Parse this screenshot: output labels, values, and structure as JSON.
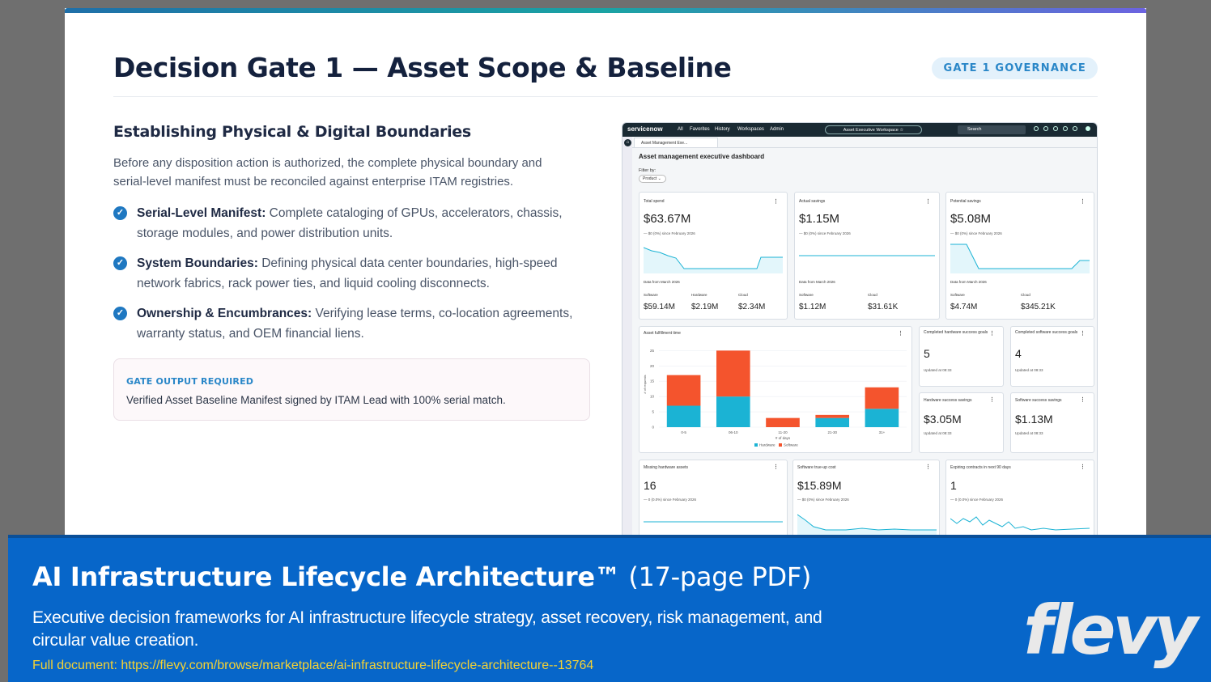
{
  "slide": {
    "title": "Decision Gate 1 — Asset Scope & Baseline",
    "badge": "GATE 1 GOVERNANCE",
    "subheading": "Establishing Physical & Digital Boundaries",
    "intro": "Before any disposition action is authorized, the complete physical boundary and serial-level manifest must be reconciled against enterprise ITAM registries.",
    "bullets": [
      {
        "title": "Serial-Level Manifest:",
        "text": " Complete cataloging of GPUs, accelerators, chassis, storage modules, and power distribution units."
      },
      {
        "title": "System Boundaries:",
        "text": " Defining physical data center boundaries, high-speed network fabrics, rack power ties, and liquid cooling disconnects."
      },
      {
        "title": "Ownership & Encumbrances:",
        "text": " Verifying lease terms, co-location agreements, warranty status, and OEM financial liens."
      }
    ],
    "output": {
      "label": "GATE OUTPUT REQUIRED",
      "text": "Verified Asset Baseline Manifest signed by ITAM Lead with 100% serial match."
    }
  },
  "dashboard": {
    "brand": "servicenow",
    "nav": [
      "All",
      "Favorites",
      "History",
      "Workspaces",
      "Admin"
    ],
    "workspace": "Asset Executive Workspace ☆",
    "search_placeholder": "Search",
    "tab": "Asset Management Exe...",
    "title": "Asset management executive dashboard",
    "filter_label": "Filter by:",
    "filter_value": "Product ⌄",
    "kpis": [
      {
        "label": "Total spend",
        "value": "$63.67M",
        "sub": "— $0 (0%) since February 2026",
        "from": "Data from March 2026",
        "breakdown": [
          {
            "label": "Software",
            "value": "$59.14M"
          },
          {
            "label": "Hardware",
            "value": "$2.19M"
          },
          {
            "label": "Cloud",
            "value": "$2.34M"
          }
        ]
      },
      {
        "label": "Actual savings",
        "value": "$1.15M",
        "sub": "— $0 (0%) since February 2026",
        "from": "Data from March 2026",
        "breakdown": [
          {
            "label": "Software",
            "value": "$1.12M"
          },
          {
            "label": "Cloud",
            "value": "$31.61K"
          }
        ]
      },
      {
        "label": "Potential savings",
        "value": "$5.08M",
        "sub": "— $0 (0%) since February 2026",
        "from": "Data from March 2026",
        "breakdown": [
          {
            "label": "Software",
            "value": "$4.74M"
          },
          {
            "label": "Cloud",
            "value": "$345.21K"
          }
        ]
      }
    ],
    "goals": [
      {
        "label": "Completed hardware success goals",
        "value": "5",
        "updated": "Updated at 08:33"
      },
      {
        "label": "Completed software success goals",
        "value": "4",
        "updated": "Updated at 08:33"
      },
      {
        "label": "Hardware success savings",
        "value": "$3.05M",
        "updated": "Updated at 08:33"
      },
      {
        "label": "Software success savings",
        "value": "$1.13M",
        "updated": "Updated at 08:33"
      }
    ],
    "bottom": [
      {
        "label": "Missing hardware assets",
        "value": "16",
        "sub": "— 0 (0.0%) since February 2026"
      },
      {
        "label": "Software true-up cost",
        "value": "$15.89M",
        "sub": "— $0 (0%) since February 2026"
      },
      {
        "label": "Expiring contracts in next 90 days",
        "value": "1",
        "sub": "— 0 (0.0%) since February 2026"
      }
    ],
    "chart_data": {
      "type": "bar",
      "title": "Asset fulfillment time",
      "categories": [
        "0-5",
        "06-10",
        "11-20",
        "21-30",
        "31+"
      ],
      "series": [
        {
          "name": "Hardware",
          "values": [
            7,
            10,
            0,
            3,
            6
          ],
          "color": "#1bb3d4"
        },
        {
          "name": "Software",
          "values": [
            10,
            15,
            3,
            1,
            7
          ],
          "color": "#f4542d"
        }
      ],
      "stacked": true,
      "xlabel": "# of days",
      "ylabel": "# of requests",
      "yticks": [
        0,
        5,
        10,
        15,
        20,
        25
      ],
      "ylim": [
        0,
        28
      ],
      "legend": "bottom"
    }
  },
  "banner": {
    "title_bold": "AI Infrastructure Lifecycle Architecture™",
    "title_light": " (17-page PDF)",
    "description": "Executive decision frameworks for AI infrastructure lifecycle strategy, asset recovery, risk management, and circular value creation.",
    "link": "Full document: https://flevy.com/browse/marketplace/ai-infrastructure-lifecycle-architecture--13764",
    "logo": "flevy"
  }
}
